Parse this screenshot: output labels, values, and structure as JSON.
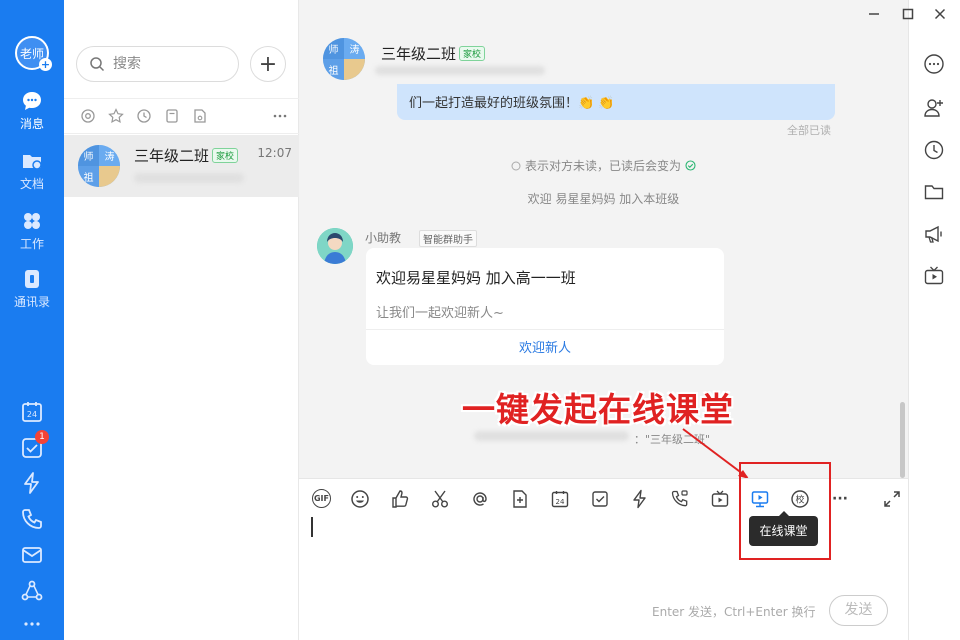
{
  "nav": {
    "avatar_label": "老师",
    "items": [
      {
        "label": "消息",
        "icon": "chat-bubble-icon"
      },
      {
        "label": "文档",
        "icon": "folder-icon"
      },
      {
        "label": "工作",
        "icon": "apps-icon"
      },
      {
        "label": "通讯录",
        "icon": "contacts-icon"
      }
    ],
    "calendar_day": "24",
    "todo_badge": "1"
  },
  "conversation_list": {
    "search_placeholder": "搜索",
    "add_label": "+",
    "items": [
      {
        "name": "三年级二班",
        "tag": "家校",
        "time": "12:07",
        "avatar_chars": [
          "师",
          "涛",
          "祖"
        ]
      }
    ]
  },
  "chat": {
    "title": "三年级二班",
    "title_tag": "家校",
    "avatar_chars": [
      "师",
      "涛",
      "祖"
    ],
    "my_message_partial": "们一起打造最好的班级氛围！👏 👏",
    "read_status": "全部已读",
    "notice_read": "表示对方未读，已读后会变为",
    "notice_welcome": "欢迎 易星星妈妈 加入本班级",
    "bot_name": "小助教",
    "bot_tag": "智能群助手",
    "card": {
      "title": "欢迎易星星妈妈 加入高一一班",
      "subtitle": "让我们一起欢迎新人~",
      "action": "欢迎新人"
    },
    "annotation_text": "一键发起在线课堂",
    "class_suffix": "：\"三年级二班\"",
    "tooltip": "在线课堂",
    "toolbar": [
      {
        "name": "gif-icon",
        "label": "GIF"
      },
      {
        "name": "emoji-icon"
      },
      {
        "name": "thumbs-up-icon"
      },
      {
        "name": "scissors-icon"
      },
      {
        "name": "mention-icon",
        "label": "@"
      },
      {
        "name": "add-file-icon"
      },
      {
        "name": "calendar-icon",
        "label": "24"
      },
      {
        "name": "todo-check-icon"
      },
      {
        "name": "lightning-icon"
      },
      {
        "name": "video-call-icon"
      },
      {
        "name": "live-icon"
      },
      {
        "name": "online-classroom-icon"
      },
      {
        "name": "school-icon",
        "label": "校"
      },
      {
        "name": "more-icon",
        "label": "···"
      },
      {
        "name": "expand-icon"
      }
    ],
    "input_hint": "Enter 发送，Ctrl+Enter 换行",
    "send_label": "发送"
  },
  "accent_color": "#1a7cf0",
  "annotation_color": "#e02222"
}
